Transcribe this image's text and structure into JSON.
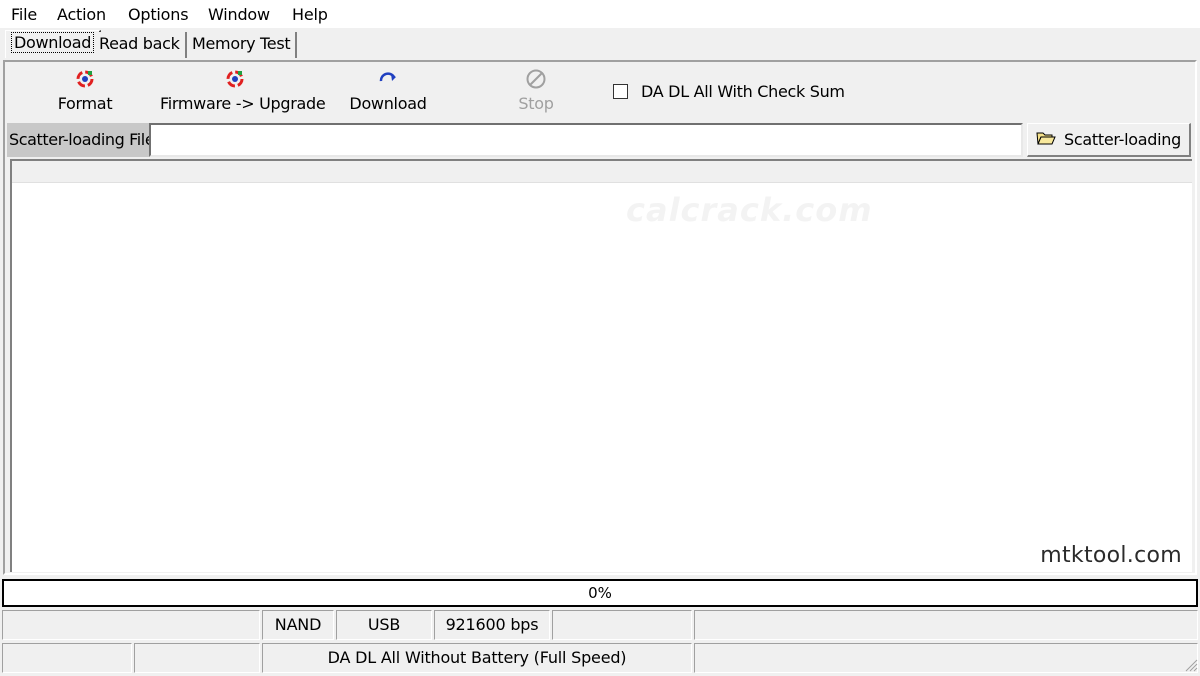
{
  "menu": [
    "File",
    "Action",
    "Options",
    "Window",
    "Help"
  ],
  "tabs": [
    "Download",
    "Read back",
    "Memory Test"
  ],
  "toolbar": {
    "format_label": "Format",
    "firmware_label": "Firmware -> Upgrade",
    "download_label": "Download",
    "stop_label": "Stop",
    "checksum_label": "DA DL All With Check Sum",
    "checksum_checked": false
  },
  "scatter": {
    "field_label": "Scatter-loading File",
    "value": "",
    "button_label": "Scatter-loading"
  },
  "watermark": "mtktool.com",
  "watermark_faint": "calcrack.com",
  "progress": {
    "value": 0,
    "text": "0%"
  },
  "status": {
    "row1": [
      "",
      "NAND",
      "USB",
      "921600 bps",
      "",
      ""
    ],
    "row2": [
      "",
      "",
      "DA DL All Without Battery (Full Speed)",
      ""
    ]
  },
  "colors": {
    "disabled_text": "#a0a0a0",
    "icon_red": "#e02020",
    "icon_blue": "#2040c0",
    "icon_green": "#20a040"
  }
}
